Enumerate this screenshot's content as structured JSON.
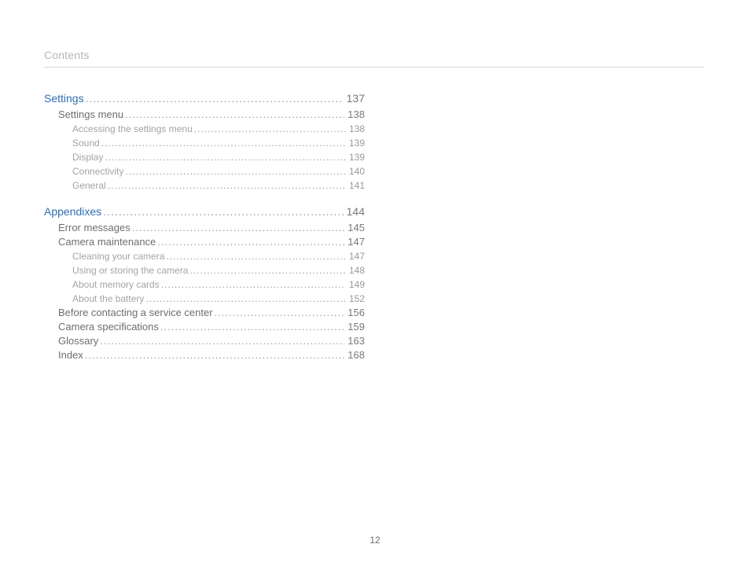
{
  "header": "Contents",
  "page_number": "12",
  "sections": [
    {
      "title": "Settings",
      "page": "137",
      "items": [
        {
          "title": "Settings menu",
          "page": "138",
          "sub": [
            {
              "title": "Accessing the settings menu",
              "page": "138"
            },
            {
              "title": "Sound",
              "page": "139"
            },
            {
              "title": "Display",
              "page": "139"
            },
            {
              "title": "Connectivity",
              "page": "140"
            },
            {
              "title": "General",
              "page": "141"
            }
          ]
        }
      ]
    },
    {
      "title": "Appendixes",
      "page": "144",
      "items": [
        {
          "title": "Error messages",
          "page": "145",
          "sub": []
        },
        {
          "title": "Camera maintenance",
          "page": "147",
          "sub": [
            {
              "title": "Cleaning your camera",
              "page": "147"
            },
            {
              "title": "Using or storing the camera",
              "page": "148"
            },
            {
              "title": "About memory cards",
              "page": "149"
            },
            {
              "title": "About the battery",
              "page": "152"
            }
          ]
        },
        {
          "title": "Before contacting a service center",
          "page": "156",
          "sub": []
        },
        {
          "title": "Camera specifications",
          "page": "159",
          "sub": []
        },
        {
          "title": "Glossary",
          "page": "163",
          "sub": []
        },
        {
          "title": "Index",
          "page": "168",
          "sub": []
        }
      ]
    }
  ]
}
